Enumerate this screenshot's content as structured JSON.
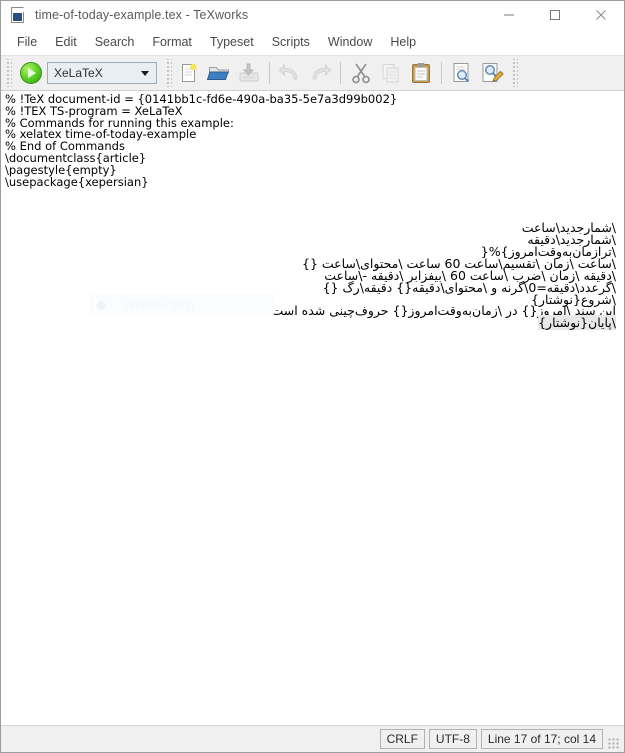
{
  "window": {
    "title": "time-of-today-example.tex - TeXworks",
    "icon": "tex-document-icon",
    "controls": [
      {
        "name": "minimize-button",
        "glyph": "minimize-icon"
      },
      {
        "name": "maximize-button",
        "glyph": "maximize-icon"
      },
      {
        "name": "close-button",
        "glyph": "close-icon"
      }
    ]
  },
  "menubar": {
    "items": [
      {
        "label": "File"
      },
      {
        "label": "Edit"
      },
      {
        "label": "Search"
      },
      {
        "label": "Format"
      },
      {
        "label": "Typeset"
      },
      {
        "label": "Scripts"
      },
      {
        "label": "Window"
      },
      {
        "label": "Help"
      }
    ]
  },
  "toolbar": {
    "typeset_button_name": "typeset-run-button",
    "engine": {
      "selected": "XeLaTeX",
      "options": [
        "XeLaTeX"
      ]
    },
    "buttons": [
      {
        "name": "new-document-button",
        "icon": "new-document-icon",
        "enabled": true
      },
      {
        "name": "open-file-button",
        "icon": "open-folder-icon",
        "enabled": true
      },
      {
        "name": "save-file-button",
        "icon": "save-disk-icon",
        "enabled": false
      },
      {
        "name": "undo-button",
        "icon": "undo-arrow-icon",
        "enabled": false
      },
      {
        "name": "redo-button",
        "icon": "redo-arrow-icon",
        "enabled": false
      },
      {
        "name": "cut-button",
        "icon": "scissors-icon",
        "enabled": true
      },
      {
        "name": "copy-button",
        "icon": "copy-pages-icon",
        "enabled": false
      },
      {
        "name": "paste-button",
        "icon": "clipboard-icon",
        "enabled": true
      },
      {
        "name": "find-button",
        "icon": "find-magnifier-icon",
        "enabled": true
      },
      {
        "name": "replace-button",
        "icon": "find-replace-pencil-icon",
        "enabled": true
      }
    ]
  },
  "editor": {
    "lines": [
      {
        "dir": "ltr",
        "text": "% !TeX document-id = {0141bb1c-fd6e-490a-ba35-5e7a3d99b002}",
        "selected": false
      },
      {
        "dir": "ltr",
        "text": "% !TEX TS-program = XeLaTeX",
        "selected": false
      },
      {
        "dir": "ltr",
        "text": "% Commands for running this example:",
        "selected": false
      },
      {
        "dir": "ltr",
        "text": "% xelatex time-of-today-example",
        "selected": false
      },
      {
        "dir": "ltr",
        "text": "% End of Commands",
        "selected": false
      },
      {
        "dir": "ltr",
        "text": "\\documentclass{article}",
        "selected": false
      },
      {
        "dir": "ltr",
        "text": "\\pagestyle{empty}",
        "selected": false
      },
      {
        "dir": "ltr",
        "text": "\\usepackage{xepersian}",
        "selected": false
      },
      {
        "dir": "ltr",
        "text": "",
        "selected": false
      },
      {
        "dir": "rtl",
        "text": "\\شمارجدید\\ساعت",
        "selected": false
      },
      {
        "dir": "rtl",
        "text": "\\شمارجدید\\دقیقه",
        "selected": false
      },
      {
        "dir": "rtl",
        "text": "\\تراز‌مان‌به‌وقت‌امروز}%{",
        "selected": false
      },
      {
        "dir": "rtl",
        "text": "\\ساعت \\زمان \\تقسیم\\ساعت 60 ساعت \\محتوای\\ساعت {}",
        "selected": false
      },
      {
        "dir": "rtl",
        "text": "\\دقیقه \\زمان \\ضرب \\ساعت 60 \\بیفزابر \\دقیقه -\\ساعت",
        "selected": false
      },
      {
        "dir": "rtl",
        "text": "\\گرعدد\\دقیقه=0\\گرنه و \\محتوای\\دقیقه{} دقیقه\\رگ {}",
        "selected": false
      },
      {
        "dir": "rtl",
        "text": "\\شروع{نوشتار}",
        "selected": false
      },
      {
        "dir": "rtl",
        "text": "این سند \\امروز{} در \\زمان‌به‌وقت‌امروز{} حروف‌چینی شده است.",
        "selected": false
      },
      {
        "dir": "rtl",
        "text": "\\پایان{نوشتار}",
        "selected": true
      }
    ]
  },
  "overlay": {
    "label": "Window Snip"
  },
  "statusbar": {
    "line_ending": "CRLF",
    "encoding": "UTF-8",
    "position": "Line 17 of 17; col 14"
  },
  "colors": {
    "toolbar_bg": "#f0f0f0",
    "window_bg": "#ffffff",
    "text": "#000000",
    "menu_text": "#4a4a4a",
    "title_text": "#5a5a5a",
    "run_green": "#5fd42a",
    "selection": "#e8e8e8"
  }
}
